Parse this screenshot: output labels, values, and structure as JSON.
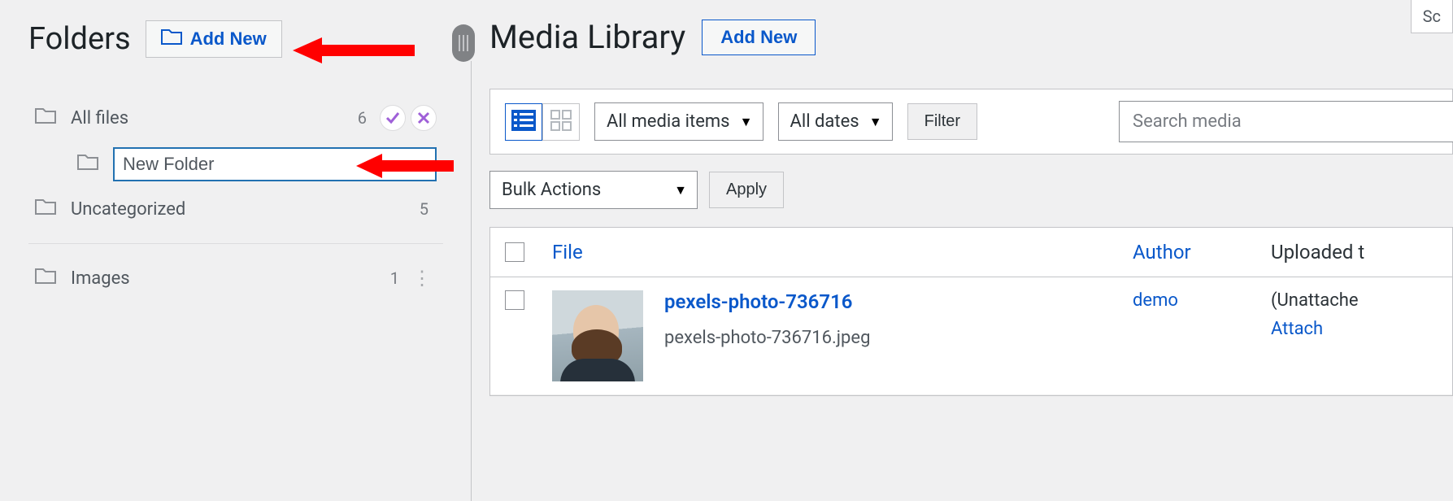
{
  "sidebar": {
    "title": "Folders",
    "add_new": "Add New",
    "rows": {
      "all_files": {
        "label": "All files",
        "count": "6"
      },
      "new_folder_value": "New Folder",
      "uncategorized": {
        "label": "Uncategorized",
        "count": "5"
      },
      "images": {
        "label": "Images",
        "count": "1"
      }
    }
  },
  "main": {
    "title": "Media Library",
    "add_new": "Add New",
    "filter_media": "All media items",
    "filter_dates": "All dates",
    "filter_btn": "Filter",
    "search_placeholder": "Search media",
    "bulk_actions": "Bulk Actions",
    "apply": "Apply",
    "columns": {
      "file": "File",
      "author": "Author",
      "uploaded": "Uploaded t"
    },
    "row1": {
      "title": "pexels-photo-736716",
      "filename": "pexels-photo-736716.jpeg",
      "author": "demo",
      "uploaded_status": "(Unattache",
      "attach": "Attach"
    },
    "screen_options": "Sc"
  }
}
